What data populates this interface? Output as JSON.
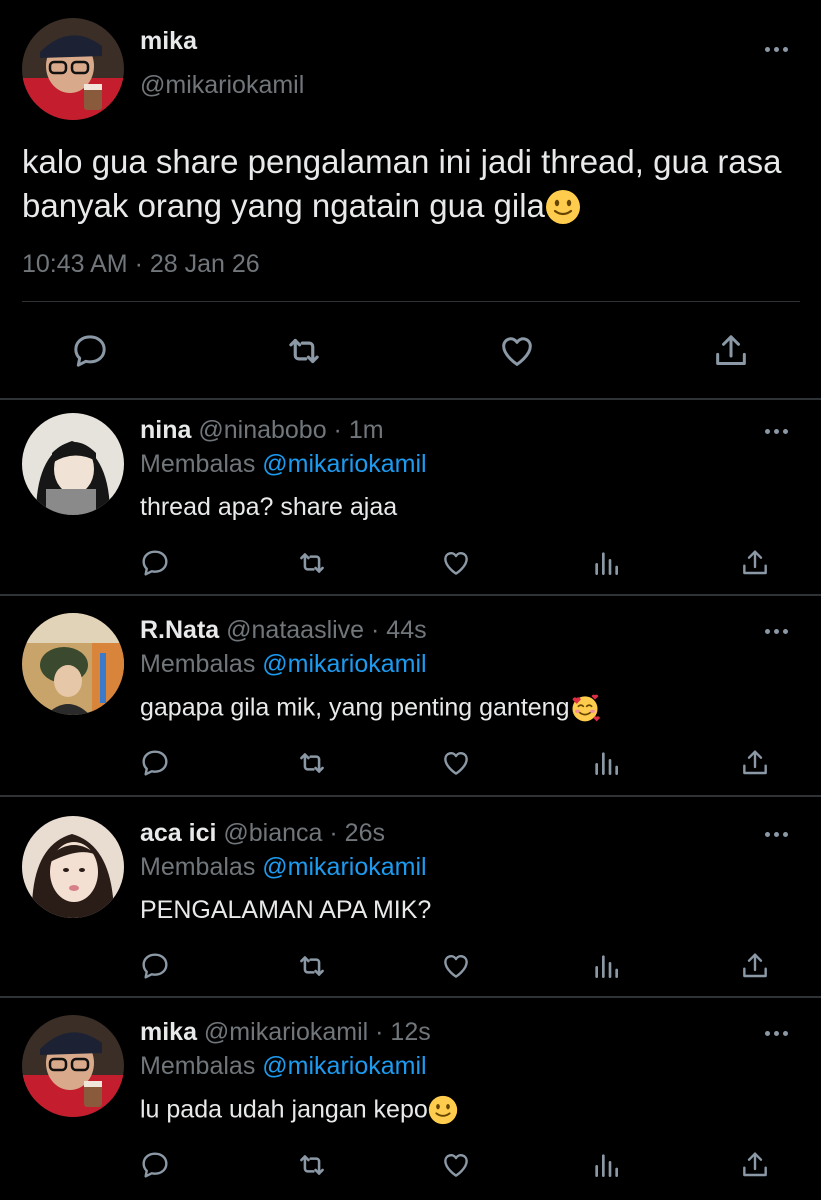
{
  "main_tweet": {
    "name": "mika",
    "handle": "@mikariokamil",
    "text": "kalo gua share pengalaman ini jadi thread, gua rasa banyak orang yang ngatain gua gila",
    "emoji": "slightly-smiling-face",
    "timestamp": "10:43 AM · 28 Jan 26",
    "icons": [
      "reply-icon",
      "retweet-icon",
      "like-icon",
      "share-icon"
    ]
  },
  "replying_prefix": "Membalas",
  "replies": [
    {
      "name": "nina",
      "meta": " @ninabobo · 1m",
      "mention": "@mikariokamil",
      "text": "thread apa? share ajaa",
      "emoji": "",
      "avatar_colors": [
        "#e9e6e2",
        "#1a1a1a"
      ]
    },
    {
      "name": "R.Nata",
      "meta": " @nataaslive · 44s",
      "mention": "@mikariokamil",
      "text": "gapapa gila mik, yang penting ganteng",
      "emoji": "smiling-face-with-hearts",
      "avatar_colors": [
        "#c8a26a",
        "#3a4a2c"
      ]
    },
    {
      "name": "aca ici",
      "meta": " @bianca · 26s",
      "mention": "@mikariokamil",
      "text": "PENGALAMAN APA MIK?",
      "emoji": "",
      "avatar_colors": [
        "#ead8cc",
        "#2a1d18"
      ]
    },
    {
      "name": "mika",
      "meta": " @mikariokamil · 12s",
      "mention": "@mikariokamil",
      "text": "lu pada udah jangan kepo",
      "emoji": "slightly-smiling-face",
      "avatar_colors": [
        "#c02030",
        "#1a1a2a"
      ]
    }
  ],
  "colors": {
    "background": "#000000",
    "text_primary": "#e7e9ea",
    "text_secondary": "#71767b",
    "mention": "#1d9bf0",
    "divider": "#2f3336",
    "icon": "#8b98a5"
  }
}
